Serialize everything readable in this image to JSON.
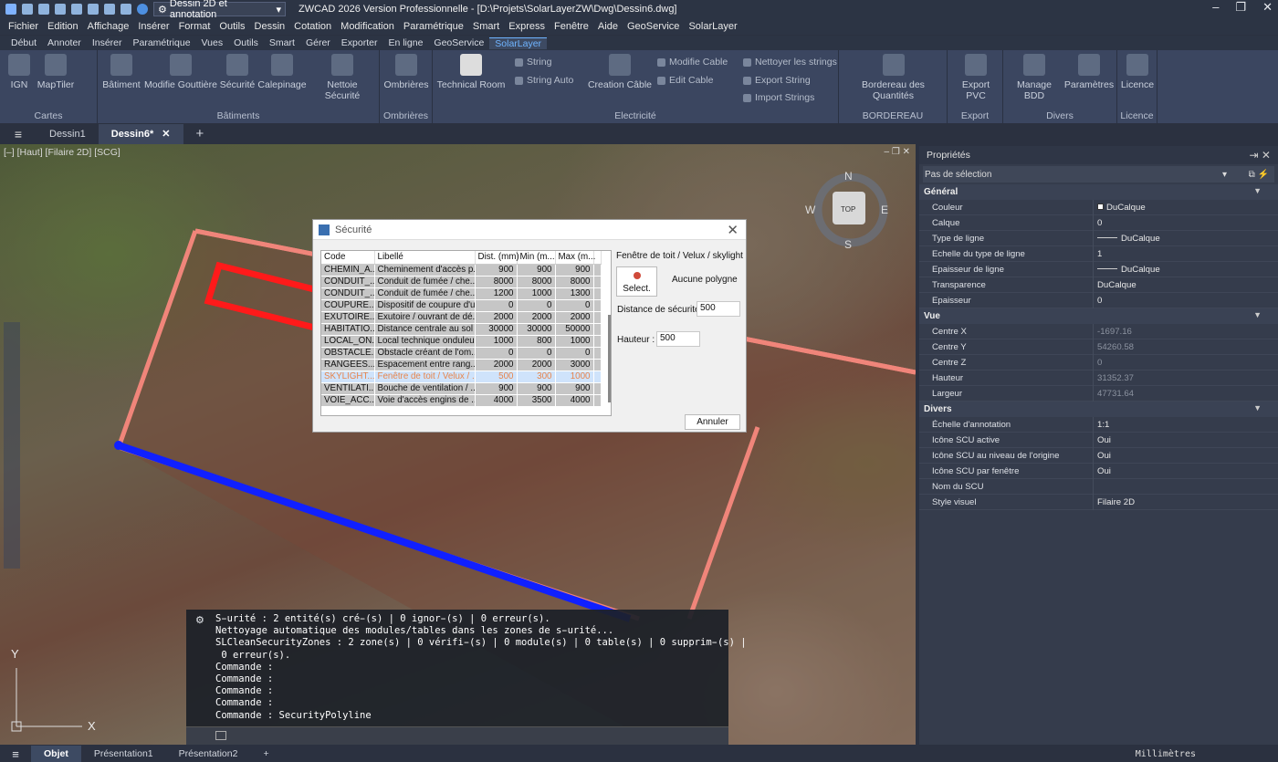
{
  "titlebar": {
    "workspace": "Dessin 2D et annotation",
    "title": "ZWCAD 2026 Version Professionnelle - [D:\\Projets\\SolarLayerZW\\Dwg\\Dessin6.dwg]"
  },
  "menu": [
    "Fichier",
    "Edition",
    "Affichage",
    "Insérer",
    "Format",
    "Outils",
    "Dessin",
    "Cotation",
    "Modification",
    "Paramétrique",
    "Smart",
    "Express",
    "Fenêtre",
    "Aide",
    "GeoService",
    "SolarLayer"
  ],
  "ribbon_tabs": [
    "Début",
    "Annoter",
    "Insérer",
    "Paramétrique",
    "Vues",
    "Outils",
    "Smart",
    "Gérer",
    "Exporter",
    "En ligne",
    "GeoService",
    "SolarLayer"
  ],
  "ribbon": {
    "cartes": {
      "title": "Cartes",
      "ign": "IGN",
      "maptiler": "MapTiler"
    },
    "batiments": {
      "title": "Bâtiments",
      "batiment": "Bâtiment",
      "gouttiere": "Modifie Gouttière",
      "securite": "Sécurité",
      "calepinage": "Calepinage",
      "nettoie": "Nettoie Sécurité"
    },
    "ombrieres": {
      "title": "Ombrières",
      "ombrieres": "Ombrières"
    },
    "electricite": {
      "title": "Electricité",
      "technical": "Technical Room",
      "string": "String",
      "string_auto": "String Auto",
      "creation_cable": "Creation Câble",
      "modifie_cable": "Modifie Cable",
      "edit_cable": "Edit Cable",
      "nettoyer": "Nettoyer les strings",
      "export_string": "Export String",
      "import_strings": "Import Strings"
    },
    "bordereau": {
      "title": "BORDEREAU",
      "label": "Bordereau des Quantités"
    },
    "export": {
      "title": "Export",
      "label": "Export PVC"
    },
    "divers": {
      "title": "Divers",
      "manage": "Manage BDD",
      "params": "Paramètres"
    },
    "licence": {
      "title": "Licence",
      "label": "Licence"
    }
  },
  "doc_tabs": [
    "Dessin1",
    "Dessin6*"
  ],
  "viewport": {
    "label": "[–] [Haut] [Filaire 2D] [SCG]",
    "compass": {
      "n": "N",
      "s": "S",
      "e": "E",
      "w": "W",
      "top": "TOP"
    },
    "ucs_x": "X",
    "ucs_y": "Y"
  },
  "command_lines": [
    "S̵urité : 2 entité(s) cré̵(s) | 0 ignor̵(s) | 0 erreur(s).",
    "Nettoyage automatique des modules/tables dans les zones de s̵urité...",
    "SLCleanSecurityZones : 2 zone(s) | 0 vérifi̵(s) | 0 module(s) | 0 table(s) | 0 supprim̵(s) |",
    " 0 erreur(s).",
    "Commande :",
    "Commande :",
    "Commande :",
    "Commande :",
    "Commande : SecurityPolyline"
  ],
  "dialog": {
    "title": "Sécurité",
    "columns": [
      "Code",
      "Libellé",
      "Dist. (mm)",
      "Min (m...",
      "Max (m...",
      ""
    ],
    "rows": [
      [
        "CHEMIN_A...",
        "Cheminement d'accès p...",
        "900",
        "900",
        "900"
      ],
      [
        "CONDUIT_...",
        "Conduit de fumée / che...",
        "8000",
        "8000",
        "8000"
      ],
      [
        "CONDUIT_...",
        "Conduit de fumée / che...",
        "1200",
        "1000",
        "1300"
      ],
      [
        "COUPURE...",
        "Dispositif de coupure d'u...",
        "0",
        "0",
        "0"
      ],
      [
        "EXUTOIRE...",
        "Exutoire / ouvrant de dé...",
        "2000",
        "2000",
        "2000"
      ],
      [
        "HABITATIO...",
        "Distance centrale au sol ...",
        "30000",
        "30000",
        "50000"
      ],
      [
        "LOCAL_ON...",
        "Local technique onduleur",
        "1000",
        "800",
        "1000"
      ],
      [
        "OBSTACLE...",
        "Obstacle créant de l'om...",
        "0",
        "0",
        "0"
      ],
      [
        "RANGEES...",
        "Espacement entre rang...",
        "2000",
        "2000",
        "3000"
      ],
      [
        "SKYLIGHT...",
        "Fenêtre de toit / Velux / ...",
        "500",
        "300",
        "1000"
      ],
      [
        "VENTILATI...",
        "Bouche de ventilation / ...",
        "900",
        "900",
        "900"
      ],
      [
        "VOIE_ACC...",
        "Voie d'accès engins de ...",
        "4000",
        "3500",
        "4000"
      ]
    ],
    "selected_row": 9,
    "group_label": "Fenêtre de toit / Velux / skylight",
    "select_button": "Select.",
    "polyline_status": "Aucune polygne",
    "distance_label": "Distance de sécurité :",
    "distance_value": "500",
    "height_label": "Hauteur :",
    "height_value": "500",
    "cancel": "Annuler"
  },
  "properties": {
    "title": "Propriétés",
    "selection": "Pas de sélection",
    "general": {
      "title": "Général",
      "rows": [
        [
          "Couleur",
          "DuCalque"
        ],
        [
          "Calque",
          "0"
        ],
        [
          "Type de ligne",
          "DuCalque"
        ],
        [
          "Echelle du type de ligne",
          "1"
        ],
        [
          "Epaisseur de ligne",
          "DuCalque"
        ],
        [
          "Transparence",
          "DuCalque"
        ],
        [
          "Epaisseur",
          "0"
        ]
      ]
    },
    "vue": {
      "title": "Vue",
      "rows": [
        [
          "Centre X",
          "-1697.16"
        ],
        [
          "Centre Y",
          "54260.58"
        ],
        [
          "Centre Z",
          "0"
        ],
        [
          "Hauteur",
          "31352.37"
        ],
        [
          "Largeur",
          "47731.64"
        ]
      ]
    },
    "divers": {
      "title": "Divers",
      "rows": [
        [
          "Échelle d'annotation",
          "1:1"
        ],
        [
          "Icône SCU active",
          "Oui"
        ],
        [
          "Icône SCU au niveau de l'origine",
          "Oui"
        ],
        [
          "Icône SCU par fenêtre",
          "Oui"
        ],
        [
          "Nom du SCU",
          ""
        ],
        [
          "Style visuel",
          "Filaire 2D"
        ]
      ]
    }
  },
  "status": {
    "layouts": [
      "Objet",
      "Présentation1",
      "Présentation2"
    ],
    "units": "Millimètres"
  },
  "colors": {
    "accent": "#6fb4ff",
    "red_outline": "#ff1a1a",
    "salmon_outline": "#f0857a",
    "blue_line": "#1020ff"
  }
}
